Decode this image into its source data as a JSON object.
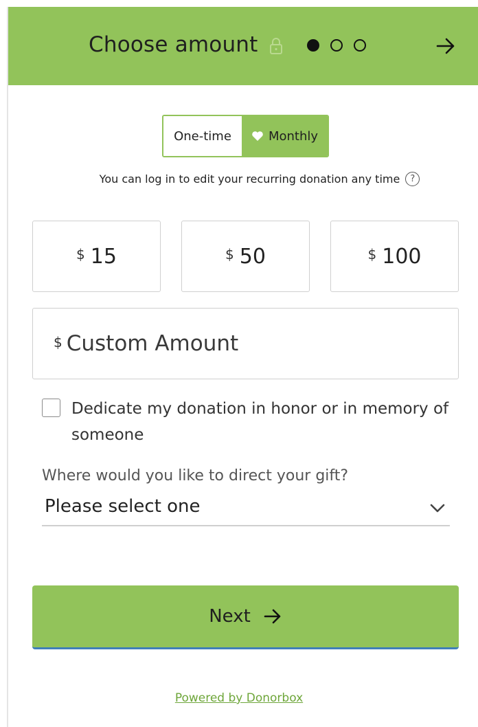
{
  "header": {
    "title": "Choose amount",
    "lock_icon": "lock-icon",
    "steps": [
      "active",
      "inactive",
      "inactive"
    ],
    "next_icon": "arrow-right-icon",
    "color": "#92c35a"
  },
  "frequency": {
    "one_time_label": "One-time",
    "monthly_label": "Monthly",
    "selected": "Monthly",
    "monthly_icon": "heart-icon"
  },
  "recurring_note": "You can log in to edit your recurring donation any time",
  "help_icon_glyph": "?",
  "amounts": [
    {
      "currency": "$",
      "value": "15"
    },
    {
      "currency": "$",
      "value": "50"
    },
    {
      "currency": "$",
      "value": "100"
    }
  ],
  "custom_amount": {
    "currency": "$",
    "placeholder": "Custom Amount"
  },
  "dedicate": {
    "label": "Dedicate my donation in honor or in memory of someone",
    "checked": false
  },
  "direct_gift": {
    "label": "Where would you like to direct your gift?",
    "selected": "Please select one"
  },
  "next_button": {
    "label": "Next"
  },
  "footer": {
    "powered_by": "Powered by Donorbox"
  },
  "colors": {
    "accent": "#92c35a",
    "link": "#6ea63a",
    "button_underline": "#3f7fba"
  }
}
